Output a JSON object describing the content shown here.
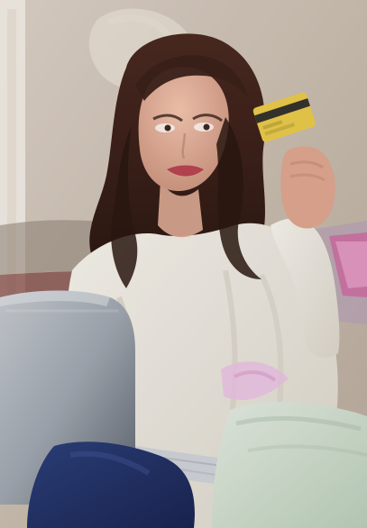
{
  "image": {
    "kind": "photo",
    "subject": "woman-with-credit-card-and-laptop",
    "colors": {
      "background_wall": "#c9bfb4",
      "sweater": "#ede8de",
      "hair": "#3a2118",
      "skin": "#d8a58f",
      "card": "#e7c84a",
      "card_stripe": "#2b2b2b",
      "laptop": "#9aa0a7",
      "jeans": "#25356b",
      "bag": "#c9dbc7",
      "pillow_pink": "#d74a9a"
    }
  }
}
